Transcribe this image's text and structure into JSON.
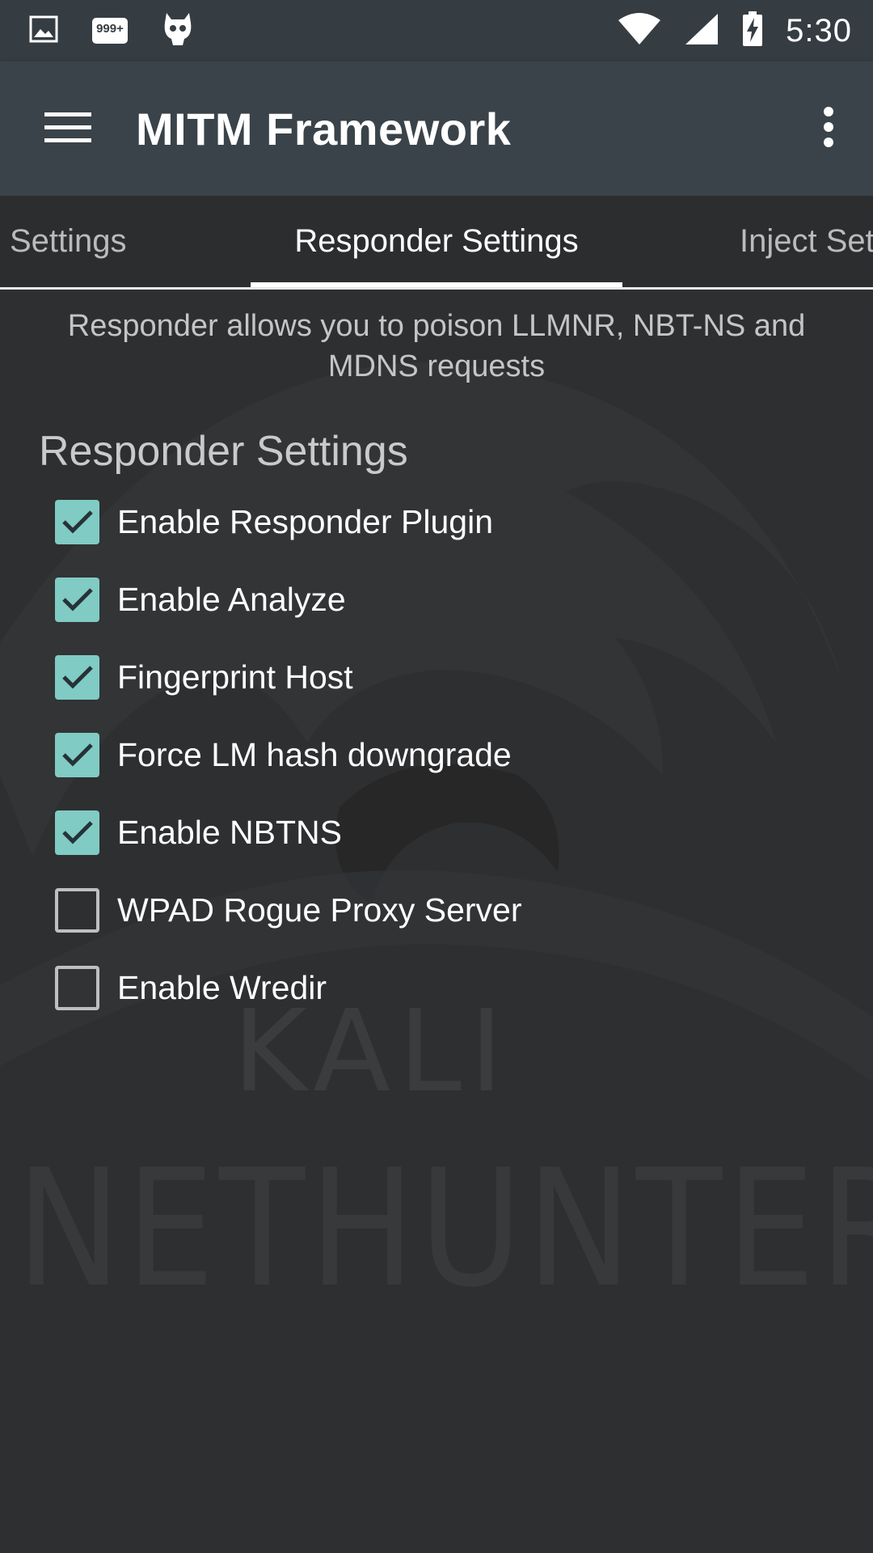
{
  "status_bar": {
    "notification_badge": "999+",
    "time": "5:30",
    "icons": [
      "image-icon",
      "notification-badge-icon",
      "cyanogen-icon",
      "wifi-icon",
      "signal-icon",
      "battery-charging-icon"
    ]
  },
  "app_bar": {
    "title": "MITM Framework",
    "menu_icon": "hamburger-icon",
    "overflow_icon": "more-vert-icon"
  },
  "tabs": [
    {
      "label": "Settings",
      "active": false
    },
    {
      "label": "Responder Settings",
      "active": true
    },
    {
      "label": "Inject Set",
      "active": false
    }
  ],
  "responder": {
    "description": "Responder allows you to poison LLMNR, NBT-NS and MDNS requests",
    "section_title": "Responder Settings",
    "options": [
      {
        "label": "Enable Responder Plugin",
        "checked": true
      },
      {
        "label": "Enable Analyze",
        "checked": true
      },
      {
        "label": "Fingerprint Host",
        "checked": true
      },
      {
        "label": "Force LM hash downgrade",
        "checked": true
      },
      {
        "label": "Enable NBTNS",
        "checked": true
      },
      {
        "label": "WPAD Rogue Proxy Server",
        "checked": false
      },
      {
        "label": "Enable Wredir",
        "checked": false
      }
    ]
  },
  "watermark": {
    "line1": "KALI",
    "line2": "NETHUNTER"
  },
  "colors": {
    "accent": "#80cbc4",
    "app_bar": "#3a4349",
    "status_bar": "#353d43",
    "background": "#2e2f30"
  }
}
